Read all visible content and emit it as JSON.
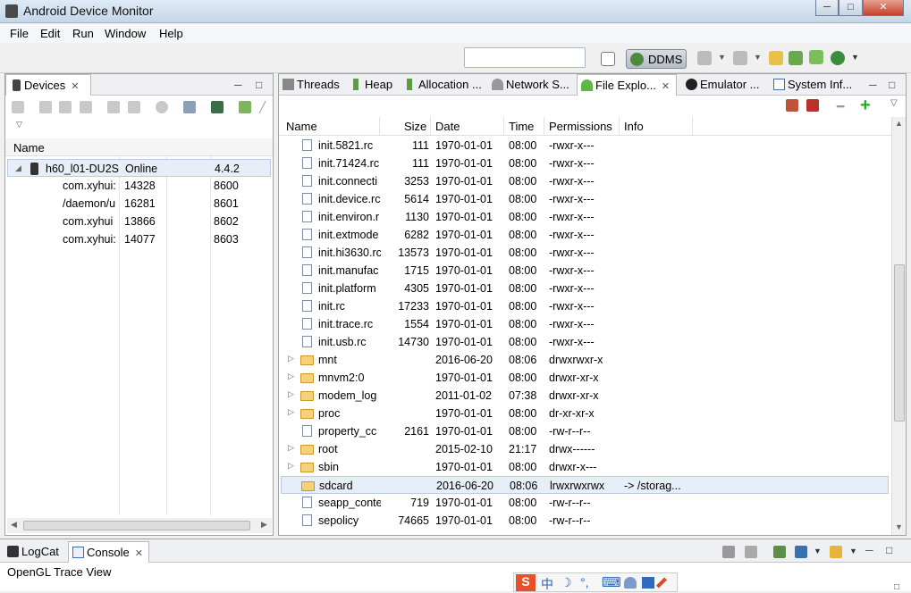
{
  "window": {
    "title": "Android Device Monitor",
    "controls": [
      "─",
      "□",
      "✕"
    ]
  },
  "menu": [
    "File",
    "Edit",
    "Run",
    "Window",
    "Help"
  ],
  "toolbar": {
    "quick_access_value": "",
    "perspective_label": "DDMS"
  },
  "devices_panel": {
    "tab_label": "Devices",
    "header_name": "Name",
    "device": {
      "name": "h60_l01-DU2S",
      "status": "Online",
      "version": "4.4.2"
    },
    "processes": [
      {
        "name": "com.xyhui:",
        "pid": "14328",
        "port": "8600"
      },
      {
        "name": "/daemon/u",
        "pid": "16281",
        "port": "8601"
      },
      {
        "name": "com.xyhui",
        "pid": "13866",
        "port": "8602"
      },
      {
        "name": "com.xyhui:",
        "pid": "14077",
        "port": "8603"
      }
    ]
  },
  "right_tabs": [
    "Threads",
    "Heap",
    "Allocation ...",
    "Network S...",
    "File Explo...",
    "Emulator ...",
    "System Inf..."
  ],
  "file_explorer": {
    "columns": [
      "Name",
      "Size",
      "Date",
      "Time",
      "Permissions",
      "Info"
    ],
    "rows": [
      {
        "type": "file",
        "name": "init.5821.rc",
        "size": "111",
        "date": "1970-01-01",
        "time": "08:00",
        "perm": "-rwxr-x---",
        "info": ""
      },
      {
        "type": "file",
        "name": "init.71424.rc",
        "size": "111",
        "date": "1970-01-01",
        "time": "08:00",
        "perm": "-rwxr-x---",
        "info": ""
      },
      {
        "type": "file",
        "name": "init.connecti",
        "size": "3253",
        "date": "1970-01-01",
        "time": "08:00",
        "perm": "-rwxr-x---",
        "info": ""
      },
      {
        "type": "file",
        "name": "init.device.rc",
        "size": "5614",
        "date": "1970-01-01",
        "time": "08:00",
        "perm": "-rwxr-x---",
        "info": ""
      },
      {
        "type": "file",
        "name": "init.environ.r",
        "size": "1130",
        "date": "1970-01-01",
        "time": "08:00",
        "perm": "-rwxr-x---",
        "info": ""
      },
      {
        "type": "file",
        "name": "init.extmode",
        "size": "6282",
        "date": "1970-01-01",
        "time": "08:00",
        "perm": "-rwxr-x---",
        "info": ""
      },
      {
        "type": "file",
        "name": "init.hi3630.rc",
        "size": "13573",
        "date": "1970-01-01",
        "time": "08:00",
        "perm": "-rwxr-x---",
        "info": ""
      },
      {
        "type": "file",
        "name": "init.manufac",
        "size": "1715",
        "date": "1970-01-01",
        "time": "08:00",
        "perm": "-rwxr-x---",
        "info": ""
      },
      {
        "type": "file",
        "name": "init.platform",
        "size": "4305",
        "date": "1970-01-01",
        "time": "08:00",
        "perm": "-rwxr-x---",
        "info": ""
      },
      {
        "type": "file",
        "name": "init.rc",
        "size": "17233",
        "date": "1970-01-01",
        "time": "08:00",
        "perm": "-rwxr-x---",
        "info": ""
      },
      {
        "type": "file",
        "name": "init.trace.rc",
        "size": "1554",
        "date": "1970-01-01",
        "time": "08:00",
        "perm": "-rwxr-x---",
        "info": ""
      },
      {
        "type": "file",
        "name": "init.usb.rc",
        "size": "14730",
        "date": "1970-01-01",
        "time": "08:00",
        "perm": "-rwxr-x---",
        "info": ""
      },
      {
        "type": "folder",
        "name": "mnt",
        "size": "",
        "date": "2016-06-20",
        "time": "08:06",
        "perm": "drwxrwxr-x",
        "info": ""
      },
      {
        "type": "folder",
        "name": "mnvm2:0",
        "size": "",
        "date": "1970-01-01",
        "time": "08:00",
        "perm": "drwxr-xr-x",
        "info": ""
      },
      {
        "type": "folder",
        "name": "modem_log",
        "size": "",
        "date": "2011-01-02",
        "time": "07:38",
        "perm": "drwxr-xr-x",
        "info": ""
      },
      {
        "type": "folder",
        "name": "proc",
        "size": "",
        "date": "1970-01-01",
        "time": "08:00",
        "perm": "dr-xr-xr-x",
        "info": ""
      },
      {
        "type": "file",
        "name": "property_cc",
        "size": "2161",
        "date": "1970-01-01",
        "time": "08:00",
        "perm": "-rw-r--r--",
        "info": ""
      },
      {
        "type": "folder",
        "name": "root",
        "size": "",
        "date": "2015-02-10",
        "time": "21:17",
        "perm": "drwx------",
        "info": ""
      },
      {
        "type": "folder",
        "name": "sbin",
        "size": "",
        "date": "1970-01-01",
        "time": "08:00",
        "perm": "drwxr-x---",
        "info": ""
      },
      {
        "type": "link",
        "name": "sdcard",
        "size": "",
        "date": "2016-06-20",
        "time": "08:06",
        "perm": "lrwxrwxrwx",
        "info": "-> /storag..."
      },
      {
        "type": "file",
        "name": "seapp_conte",
        "size": "719",
        "date": "1970-01-01",
        "time": "08:00",
        "perm": "-rw-r--r--",
        "info": ""
      },
      {
        "type": "file",
        "name": "sepolicy",
        "size": "74665",
        "date": "1970-01-01",
        "time": "08:00",
        "perm": "-rw-r--r--",
        "info": ""
      }
    ]
  },
  "bottom": {
    "tabs": [
      "LogCat",
      "Console"
    ],
    "console_text": "OpenGL Trace View"
  },
  "ime_bar": [
    "中",
    "☽",
    "°,",
    "⌨"
  ],
  "colors": {
    "accent": "#3b74c3",
    "selection": "#e8eef8",
    "folder": "#f5d27a"
  }
}
